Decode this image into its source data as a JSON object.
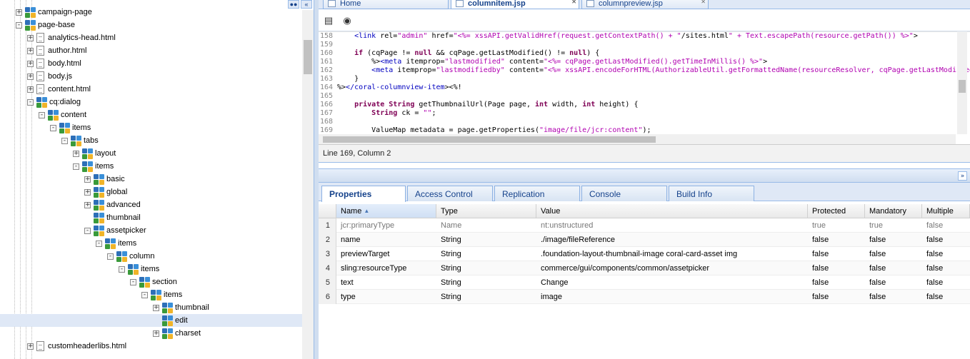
{
  "tree": {
    "nodes": [
      {
        "label": "campaign-page",
        "icon": "node-icon",
        "expander": "+",
        "level": 5
      },
      {
        "label": "page-base",
        "icon": "node-icon",
        "expander": "-",
        "level": 5
      },
      {
        "label": "analytics-head.html",
        "icon": "file-icon",
        "expander": "+",
        "level": 6
      },
      {
        "label": "author.html",
        "icon": "file-icon",
        "expander": "+",
        "level": 6
      },
      {
        "label": "body.html",
        "icon": "file-icon",
        "expander": "+",
        "level": 6
      },
      {
        "label": "body.js",
        "icon": "file-icon",
        "expander": "+",
        "level": 6
      },
      {
        "label": "content.html",
        "icon": "file-icon",
        "expander": "+",
        "level": 6
      },
      {
        "label": "cq:dialog",
        "icon": "node-icon",
        "expander": "-",
        "level": 6
      },
      {
        "label": "content",
        "icon": "node-icon",
        "expander": "-",
        "level": 7
      },
      {
        "label": "items",
        "icon": "node-icon",
        "expander": "-",
        "level": 8
      },
      {
        "label": "tabs",
        "icon": "node-icon",
        "expander": "-",
        "level": 9
      },
      {
        "label": "layout",
        "icon": "node-icon",
        "expander": "+",
        "level": 10
      },
      {
        "label": "items",
        "icon": "node-icon",
        "expander": "-",
        "level": 10
      },
      {
        "label": "basic",
        "icon": "node-icon",
        "expander": "+",
        "level": 11
      },
      {
        "label": "global",
        "icon": "node-icon",
        "expander": "+",
        "level": 11
      },
      {
        "label": "advanced",
        "icon": "node-icon",
        "expander": "+",
        "level": 11
      },
      {
        "label": "thumbnail",
        "icon": "node-icon",
        "expander": "",
        "level": 11
      },
      {
        "label": "assetpicker",
        "icon": "node-icon",
        "expander": "-",
        "level": 11
      },
      {
        "label": "items",
        "icon": "node-icon",
        "expander": "-",
        "level": 12
      },
      {
        "label": "column",
        "icon": "node-icon",
        "expander": "-",
        "level": 13
      },
      {
        "label": "items",
        "icon": "node-icon",
        "expander": "-",
        "level": 14
      },
      {
        "label": "section",
        "icon": "node-icon",
        "expander": "-",
        "level": 15
      },
      {
        "label": "items",
        "icon": "node-icon",
        "expander": "-",
        "level": 16
      },
      {
        "label": "thumbnail",
        "icon": "node-icon",
        "expander": "+",
        "level": 17
      },
      {
        "label": "edit",
        "icon": "node-icon",
        "expander": "",
        "level": 17,
        "selected": true
      },
      {
        "label": "charset",
        "icon": "node-icon",
        "expander": "+",
        "level": 17
      },
      {
        "label": "customheaderlibs.html",
        "icon": "file-icon",
        "expander": "+",
        "level": 6
      }
    ],
    "toolbar_icons": [
      "binoculars-icon",
      "collapse-left-icon"
    ]
  },
  "editor": {
    "tabs": [
      {
        "label": "Home",
        "active": false,
        "closable": false
      },
      {
        "label": "columnitem.jsp",
        "active": true,
        "closable": true
      },
      {
        "label": "columnpreview.jsp",
        "active": false,
        "closable": true
      }
    ],
    "toolbar_icons": [
      "format-icon",
      "binoculars-icon"
    ],
    "lines": [
      {
        "n": "158",
        "text": "    <link rel=\"admin\" href=\"<%= xssAPI.getValidHref(request.getContextPath() + \"/sites.html\" + Text.escapePath(resource.getPath()) %>\">"
      },
      {
        "n": "159",
        "text": ""
      },
      {
        "n": "160",
        "text": "    if (cqPage != null && cqPage.getLastModified() != null) {"
      },
      {
        "n": "161",
        "text": "        %><meta itemprop=\"lastmodified\" content=\"<%= cqPage.getLastModified().getTimeInMillis() %>\">"
      },
      {
        "n": "162",
        "text": "        <meta itemprop=\"lastmodifiedby\" content=\"<%= xssAPI.encodeForHTML(AuthorizableUtil.getFormattedName(resourceResolver, cqPage.getLastModifiedBy())) %>\">"
      },
      {
        "n": "163",
        "text": "    }"
      },
      {
        "n": "164",
        "text": "%></coral-columnview-item><%!"
      },
      {
        "n": "165",
        "text": ""
      },
      {
        "n": "166",
        "text": "    private String getThumbnailUrl(Page page, int width, int height) {"
      },
      {
        "n": "167",
        "text": "        String ck = \"\";"
      },
      {
        "n": "168",
        "text": ""
      },
      {
        "n": "169",
        "text": "        ValueMap metadata = page.getProperties(\"image/file/jcr:content\");"
      }
    ],
    "status": "Line 169, Column 2"
  },
  "properties": {
    "tabs": [
      {
        "label": "Properties",
        "active": true
      },
      {
        "label": "Access Control",
        "active": false
      },
      {
        "label": "Replication",
        "active": false
      },
      {
        "label": "Console",
        "active": false
      },
      {
        "label": "Build Info",
        "active": false
      }
    ],
    "columns": [
      "Name",
      "Type",
      "Value",
      "Protected",
      "Mandatory",
      "Multiple"
    ],
    "sorted_column": "Name",
    "sort_indicator": "▲",
    "rows": [
      {
        "n": "1",
        "name": "jcr:primaryType",
        "type": "Name",
        "value": "nt:unstructured",
        "protected": "true",
        "mandatory": "true",
        "multiple": "false",
        "readonly": true
      },
      {
        "n": "2",
        "name": "name",
        "type": "String",
        "value": "./image/fileReference",
        "protected": "false",
        "mandatory": "false",
        "multiple": "false"
      },
      {
        "n": "3",
        "name": "previewTarget",
        "type": "String",
        "value": ".foundation-layout-thumbnail-image coral-card-asset img",
        "protected": "false",
        "mandatory": "false",
        "multiple": "false"
      },
      {
        "n": "4",
        "name": "sling:resourceType",
        "type": "String",
        "value": "commerce/gui/components/common/assetpicker",
        "protected": "false",
        "mandatory": "false",
        "multiple": "false"
      },
      {
        "n": "5",
        "name": "text",
        "type": "String",
        "value": "Change",
        "protected": "false",
        "mandatory": "false",
        "multiple": "false"
      },
      {
        "n": "6",
        "name": "type",
        "type": "String",
        "value": "image",
        "protected": "false",
        "mandatory": "false",
        "multiple": "false"
      }
    ]
  },
  "colors": {
    "accent": "#15428b",
    "panel_border": "#99bbe8",
    "selection": "#dfe8f6",
    "code_tag": "#0000c0",
    "code_string": "#b000b0",
    "code_keyword": "#7f0055"
  }
}
